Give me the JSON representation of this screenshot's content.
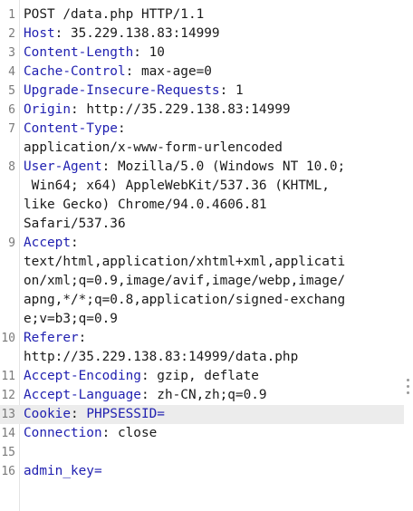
{
  "request": {
    "request_line": "POST /data.php HTTP/1.1",
    "headers": [
      {
        "n": 2,
        "key": "Host",
        "value": "35.229.138.83:14999"
      },
      {
        "n": 3,
        "key": "Content-Length",
        "value": "10"
      },
      {
        "n": 4,
        "key": "Cache-Control",
        "value": "max-age=0"
      },
      {
        "n": 5,
        "key": "Upgrade-Insecure-Requests",
        "value": "1"
      },
      {
        "n": 6,
        "key": "Origin",
        "value": "http://35.229.138.83:14999"
      },
      {
        "n": 7,
        "key": "Content-Type",
        "value_lines": [
          "application/x-www-form-urlencoded"
        ]
      },
      {
        "n": 8,
        "key": "User-Agent",
        "value_first": "Mozilla/5.0 (Windows NT 10.0;",
        "value_lines": [
          " Win64; x64) AppleWebKit/537.36 (KHTML,",
          "like Gecko) Chrome/94.0.4606.81",
          "Safari/537.36"
        ]
      },
      {
        "n": 9,
        "key": "Accept",
        "value_lines": [
          "text/html,application/xhtml+xml,applicati",
          "on/xml;q=0.9,image/avif,image/webp,image/",
          "apng,*/*;q=0.8,application/signed-exchang",
          "e;v=b3;q=0.9"
        ]
      },
      {
        "n": 10,
        "key": "Referer",
        "value_lines": [
          "http://35.229.138.83:14999/data.php"
        ]
      },
      {
        "n": 11,
        "key": "Accept-Encoding",
        "value": "gzip, deflate"
      },
      {
        "n": 12,
        "key": "Accept-Language",
        "value": "zh-CN,zh;q=0.9"
      },
      {
        "n": 13,
        "key": "Cookie",
        "value": "PHPSESSID="
      },
      {
        "n": 14,
        "key": "Connection",
        "value": "close"
      }
    ],
    "body": "admin_key="
  },
  "line_numbers": [
    "1",
    "2",
    "3",
    "4",
    "5",
    "6",
    "7",
    "8",
    "9",
    "10",
    "11",
    "12",
    "13",
    "14",
    "15",
    "16"
  ],
  "colors": {
    "header_key": "#1f1fb0",
    "highlight_row": "#ececec",
    "gutter_text": "#7a7a7a"
  }
}
